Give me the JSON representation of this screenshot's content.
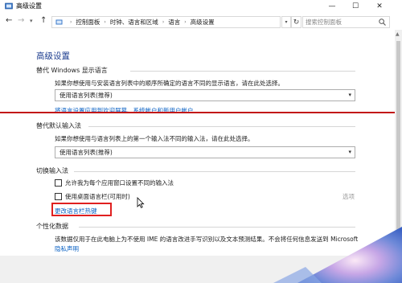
{
  "window": {
    "title": "高级设置",
    "controls": {
      "minimize": "—",
      "maximize": "☐",
      "close": "✕"
    }
  },
  "nav": {
    "back": "←",
    "forward": "→",
    "dropdown": "▾",
    "up": "↑",
    "breadcrumb": [
      "控制面板",
      "时钟、语言和区域",
      "语言",
      "高级设置"
    ],
    "breadcrumb_sep": "›",
    "refresh": "↻",
    "search_placeholder": "搜索控制面板"
  },
  "page": {
    "title": "高级设置",
    "display_language": {
      "heading": "替代 Windows 显示语言",
      "description": "如果你想使用与安装语言列表中的顺序所确定的语言不同的显示语言，请在此处选择。",
      "select_value": "使用语言列表(推荐)",
      "link": "将语言设置应用到欢迎屏幕、系统帐户和新用户帐户"
    },
    "default_input": {
      "heading": "替代默认输入法",
      "description": "如果你想使用与语言列表上的第一个输入法不同的输入法，请在此处选择。",
      "select_value": "使用语言列表(推荐)"
    },
    "switch_input": {
      "heading": "切换输入法",
      "checkbox1": "允许我为每个应用窗口设置不同的输入法",
      "checkbox2": "使用桌面语言栏(可用时)",
      "options": "选项",
      "hotkey_link": "更改语言栏热键"
    },
    "personalization": {
      "heading": "个性化数据",
      "description": "该数据仅用于在此电脑上为不使用 IME 的语言改进手写识别以及文本预测结果。不会将任何信息发送到 Microsoft",
      "privacy_link": "隐私声明"
    }
  },
  "colors": {
    "accent": "#1e3e8f",
    "link": "#0b62c4",
    "highlight": "#e02020"
  }
}
